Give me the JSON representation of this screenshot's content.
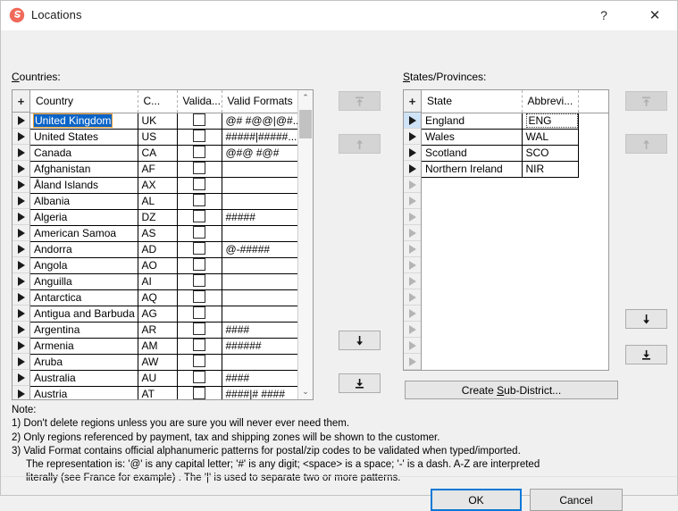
{
  "window": {
    "title": "Locations",
    "icon": "app-swirl-icon",
    "icon_color": "#ef6a5a",
    "help_glyph": "?",
    "close_glyph": "✕"
  },
  "countries_panel": {
    "label": "Countries:",
    "label_accel": "C",
    "add_button": "+",
    "columns": [
      "Country",
      "C...",
      "Valida...",
      "Valid Formats"
    ],
    "rows": [
      {
        "country": "United Kingdom",
        "code": "UK",
        "validate": false,
        "formats": "@# #@@|@#...",
        "selected": true
      },
      {
        "country": "United States",
        "code": "US",
        "validate": false,
        "formats": "#####|#####...",
        "selected": false
      },
      {
        "country": "Canada",
        "code": "CA",
        "validate": false,
        "formats": "@#@ #@#",
        "selected": false
      },
      {
        "country": "Afghanistan",
        "code": "AF",
        "validate": false,
        "formats": "",
        "selected": false
      },
      {
        "country": "Åland Islands",
        "code": "AX",
        "validate": false,
        "formats": "",
        "selected": false
      },
      {
        "country": "Albania",
        "code": "AL",
        "validate": false,
        "formats": "",
        "selected": false
      },
      {
        "country": "Algeria",
        "code": "DZ",
        "validate": false,
        "formats": "#####",
        "selected": false
      },
      {
        "country": "American Samoa",
        "code": "AS",
        "validate": false,
        "formats": "",
        "selected": false
      },
      {
        "country": "Andorra",
        "code": "AD",
        "validate": false,
        "formats": "@-#####",
        "selected": false
      },
      {
        "country": "Angola",
        "code": "AO",
        "validate": false,
        "formats": "",
        "selected": false
      },
      {
        "country": "Anguilla",
        "code": "AI",
        "validate": false,
        "formats": "",
        "selected": false
      },
      {
        "country": "Antarctica",
        "code": "AQ",
        "validate": false,
        "formats": "",
        "selected": false
      },
      {
        "country": "Antigua and Barbuda",
        "code": "AG",
        "validate": false,
        "formats": "",
        "selected": false
      },
      {
        "country": "Argentina",
        "code": "AR",
        "validate": false,
        "formats": "####",
        "selected": false
      },
      {
        "country": "Armenia",
        "code": "AM",
        "validate": false,
        "formats": "######",
        "selected": false
      },
      {
        "country": "Aruba",
        "code": "AW",
        "validate": false,
        "formats": "",
        "selected": false
      },
      {
        "country": "Australia",
        "code": "AU",
        "validate": false,
        "formats": "####",
        "selected": false
      },
      {
        "country": "Austria",
        "code": "AT",
        "validate": false,
        "formats": "####|#  ####",
        "selected": false
      }
    ],
    "scrollbar": {
      "up_glyph": "⌃",
      "down_glyph": "⌄"
    }
  },
  "states_panel": {
    "label": "States/Provinces:",
    "label_accel": "S",
    "add_button": "+",
    "columns": [
      "State",
      "Abbrevi...",
      ""
    ],
    "rows": [
      {
        "state": "England",
        "abbrev": "ENG",
        "current": true,
        "focused": true
      },
      {
        "state": "Wales",
        "abbrev": "WAL",
        "current": false,
        "focused": false
      },
      {
        "state": "Scotland",
        "abbrev": "SCO",
        "current": false,
        "focused": false
      },
      {
        "state": "Northern Ireland",
        "abbrev": "NIR",
        "current": false,
        "focused": false
      }
    ],
    "empty_row_count": 12
  },
  "move_buttons_countries": [
    {
      "name": "move-to-top",
      "glyph": "top",
      "enabled": false
    },
    {
      "name": "move-up",
      "glyph": "up",
      "enabled": false
    },
    {
      "name": "move-down",
      "glyph": "down",
      "enabled": true
    },
    {
      "name": "move-to-bottom",
      "glyph": "bottom",
      "enabled": true
    }
  ],
  "move_buttons_states": [
    {
      "name": "move-to-top",
      "glyph": "top",
      "enabled": false
    },
    {
      "name": "move-up",
      "glyph": "up",
      "enabled": false
    },
    {
      "name": "move-down",
      "glyph": "down",
      "enabled": true
    },
    {
      "name": "move-to-bottom",
      "glyph": "bottom",
      "enabled": true
    }
  ],
  "buttons": {
    "subdistrict_pre": "Create ",
    "subdistrict_accel": "S",
    "subdistrict_post": "ub-District...",
    "ok": "OK",
    "cancel": "Cancel"
  },
  "note": {
    "heading": "Note:",
    "line1": "1) Don't delete regions unless you are sure you will never ever need them.",
    "line2": "2) Only regions referenced by payment, tax and shipping zones will be shown to the customer.",
    "line3": "3) Valid Format contains official alphanumeric patterns for postal/zip codes to be validated when typed/imported.",
    "line4": "The representation is: '@' is any capital letter; '#' is any digit; <space> is a space; '-' is a dash. A-Z are interpreted",
    "line5": "literally (see France for example) . The '|' is used to separate two or more patterns."
  }
}
